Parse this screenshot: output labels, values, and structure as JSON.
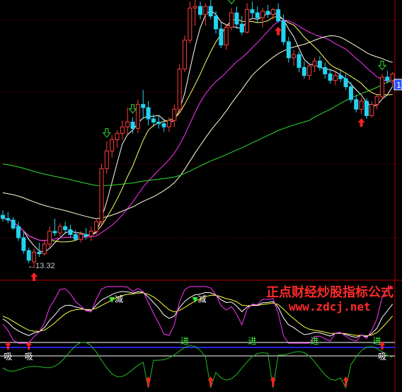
{
  "chart_data": [
    {
      "type": "candlestick",
      "panel": "main",
      "title": "",
      "ylim": [
        12.6,
        30.0
      ],
      "grid": true,
      "low_annotation": "13.32",
      "price_tag": "1",
      "colors": {
        "up": "#ff3b3b",
        "down": "#22d3f0",
        "ma5": "#ffffff",
        "ma10": "#ffff66",
        "ma20": "#ff33ff",
        "ma30": "#ffffd8",
        "ma60": "#33dd33",
        "grid": "#8b0000"
      },
      "candles": [
        [
          16.6,
          16.9,
          16.2,
          16.4
        ],
        [
          16.4,
          16.8,
          16.1,
          16.3
        ],
        [
          16.3,
          16.5,
          15.7,
          15.8
        ],
        [
          15.9,
          16.2,
          15.0,
          15.2
        ],
        [
          15.2,
          15.6,
          14.2,
          14.4
        ],
        [
          14.4,
          14.6,
          13.6,
          13.8
        ],
        [
          13.7,
          14.5,
          13.3,
          14.3
        ],
        [
          14.3,
          14.9,
          14.0,
          14.2
        ],
        [
          14.2,
          15.0,
          14.1,
          14.8
        ],
        [
          14.8,
          15.9,
          14.6,
          15.6
        ],
        [
          15.6,
          16.4,
          15.3,
          15.5
        ],
        [
          15.5,
          16.1,
          15.3,
          15.9
        ],
        [
          15.9,
          16.2,
          15.5,
          15.7
        ],
        [
          15.7,
          16.0,
          15.2,
          15.4
        ],
        [
          15.4,
          15.7,
          15.0,
          15.1
        ],
        [
          15.1,
          15.6,
          14.9,
          15.4
        ],
        [
          15.4,
          15.8,
          15.1,
          15.3
        ],
        [
          15.3,
          15.9,
          15.0,
          15.6
        ],
        [
          15.6,
          16.4,
          15.4,
          16.2
        ],
        [
          16.2,
          19.8,
          16.0,
          19.5
        ],
        [
          19.5,
          21.2,
          19.2,
          20.6
        ],
        [
          20.6,
          21.6,
          20.2,
          21.3
        ],
        [
          21.3,
          21.9,
          20.8,
          21.7
        ],
        [
          21.7,
          22.5,
          21.3,
          22.1
        ],
        [
          22.1,
          23.3,
          21.6,
          22.4
        ],
        [
          22.4,
          22.7,
          21.7,
          22.0
        ],
        [
          22.0,
          23.8,
          21.7,
          23.5
        ],
        [
          23.5,
          24.4,
          22.6,
          23.3
        ],
        [
          23.3,
          23.7,
          22.2,
          22.6
        ],
        [
          22.6,
          22.9,
          22.1,
          22.4
        ],
        [
          22.4,
          22.8,
          22.0,
          22.3
        ],
        [
          22.3,
          22.6,
          21.8,
          22.1
        ],
        [
          22.1,
          22.7,
          21.8,
          22.5
        ],
        [
          22.5,
          23.5,
          22.1,
          23.2
        ],
        [
          23.2,
          26.0,
          23.0,
          25.7
        ],
        [
          25.7,
          27.8,
          25.5,
          27.5
        ],
        [
          27.5,
          29.9,
          27.3,
          29.5
        ],
        [
          29.5,
          30.0,
          28.4,
          29.6
        ],
        [
          29.6,
          29.9,
          28.8,
          29.1
        ],
        [
          29.1,
          29.8,
          28.4,
          29.6
        ],
        [
          29.6,
          30.0,
          28.8,
          29.0
        ],
        [
          29.0,
          29.3,
          27.9,
          28.2
        ],
        [
          28.2,
          28.6,
          27.0,
          27.2
        ],
        [
          27.2,
          28.5,
          26.9,
          28.3
        ],
        [
          28.3,
          29.5,
          28.1,
          29.2
        ],
        [
          29.2,
          29.6,
          28.2,
          28.5
        ],
        [
          28.5,
          29.0,
          27.8,
          28.0
        ],
        [
          28.0,
          29.8,
          27.9,
          29.4
        ],
        [
          29.4,
          29.9,
          28.9,
          29.2
        ],
        [
          29.2,
          29.6,
          28.6,
          28.9
        ],
        [
          28.9,
          29.5,
          28.3,
          29.3
        ],
        [
          29.3,
          29.7,
          28.9,
          29.1
        ],
        [
          29.1,
          29.5,
          28.8,
          29.4
        ],
        [
          29.4,
          29.8,
          28.6,
          28.7
        ],
        [
          28.7,
          29.1,
          27.2,
          27.4
        ],
        [
          27.4,
          27.7,
          26.1,
          26.4
        ],
        [
          26.4,
          26.9,
          25.9,
          26.6
        ],
        [
          26.6,
          26.8,
          25.5,
          25.8
        ],
        [
          25.8,
          26.2,
          25.1,
          25.3
        ],
        [
          25.3,
          26.0,
          25.0,
          25.9
        ],
        [
          25.9,
          26.4,
          25.5,
          26.2
        ],
        [
          26.2,
          26.5,
          25.6,
          25.8
        ],
        [
          25.8,
          26.1,
          25.1,
          25.4
        ],
        [
          25.4,
          25.7,
          24.8,
          25.0
        ],
        [
          25.0,
          25.6,
          24.7,
          25.3
        ],
        [
          25.3,
          25.7,
          24.9,
          25.1
        ],
        [
          25.1,
          25.4,
          24.4,
          24.6
        ],
        [
          24.6,
          24.9,
          23.6,
          23.8
        ],
        [
          23.8,
          24.1,
          23.0,
          23.2
        ],
        [
          23.2,
          23.9,
          22.9,
          23.7
        ],
        [
          23.7,
          23.9,
          22.6,
          22.8
        ],
        [
          22.8,
          23.7,
          22.7,
          23.5
        ],
        [
          23.5,
          24.1,
          23.2,
          24.0
        ],
        [
          24.0,
          25.4,
          23.8,
          25.2
        ],
        [
          25.2,
          25.6,
          24.8,
          25.0
        ],
        [
          25.0,
          25.5,
          24.6,
          25.4
        ]
      ],
      "signals_main": {
        "up_arrows": [
          6,
          53,
          69
        ],
        "down_arrows": [
          20,
          25,
          44,
          73
        ]
      },
      "lower_panel": {
        "type": "line",
        "title_overlay": [
          "正点财经炒股指标公式",
          "www.zdcj.net"
        ],
        "upper_labels": {
          "sell": "减",
          "buy": "进"
        },
        "bottom_labels": {
          "absorb": "吸"
        },
        "k_line_color": "#ffffff",
        "d_line_color": "#ffff33",
        "j_line_color": "#ff33ff",
        "green_line_color": "#22bb22",
        "buy_bars": [
          35,
          48,
          60,
          72
        ],
        "absorb_indices": [
          1,
          5,
          73
        ],
        "sell_indices": [
          21,
          37
        ],
        "spike_down_indices": [
          28,
          40,
          52,
          66
        ]
      }
    }
  ]
}
